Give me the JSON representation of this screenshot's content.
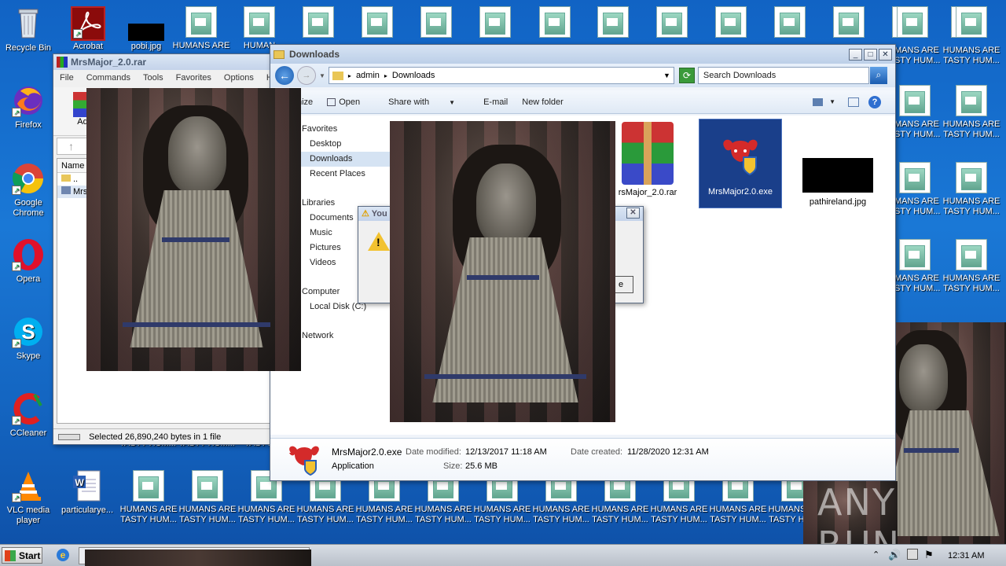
{
  "desktop": {
    "left_icons": [
      {
        "label": "Recycle Bin",
        "icon": "recycle-bin-icon"
      },
      {
        "label": "Acrobat",
        "icon": "acrobat-icon"
      },
      {
        "label": "Firefox",
        "icon": "firefox-icon"
      },
      {
        "label": "Google Chrome",
        "icon": "chrome-icon"
      },
      {
        "label": "Opera",
        "icon": "opera-icon"
      },
      {
        "label": "Skype",
        "icon": "skype-icon"
      },
      {
        "label": "CCleaner",
        "icon": "ccleaner-icon"
      },
      {
        "label": "VLC media player",
        "icon": "vlc-icon"
      },
      {
        "label": "particularye...",
        "icon": "word-doc-icon"
      },
      {
        "label": "pobi.jpg",
        "icon": "image-file-icon"
      }
    ],
    "spam_label_line1": "HUMANS ARE",
    "spam_label_line2": "TASTY HUM...",
    "spam_label_partial": "MANS ARE",
    "spam_label_partial2": "STY HUM...",
    "spam_label_cut": "TASTY HUM...",
    "spam_label_cut2": "HUMANS ARE",
    "spam_label_small": "HUMAN",
    "spam_label_tiny": "TASTY HU",
    "spam_label_edge": "TASTY HU",
    "spam_label_hum_edge": "HUMANS",
    "watermark": "ANY RUN"
  },
  "winrar": {
    "title": "MrsMajor_2.0.rar",
    "menu": [
      "File",
      "Commands",
      "Tools",
      "Favorites",
      "Options",
      "Help"
    ],
    "toolbar_add": "Ad",
    "column_name": "Name",
    "rows": [
      "..",
      "Mrs"
    ],
    "status": "Selected 26,890,240 bytes in 1 file"
  },
  "explorer": {
    "title": "Downloads",
    "breadcrumb": [
      "admin",
      "Downloads"
    ],
    "search_placeholder": "Search Downloads",
    "toolbar": [
      "nize",
      "Open",
      "Share with",
      "E-mail",
      "New folder"
    ],
    "nav": {
      "favorites": "Favorites",
      "desktop": "Desktop",
      "downloads": "Downloads",
      "recent": "Recent Places",
      "libraries": "Libraries",
      "documents": "Documents",
      "music": "Music",
      "pictures": "Pictures",
      "videos": "Videos",
      "computer": "Computer",
      "local_disk": "Local Disk (C:)",
      "network": "Network"
    },
    "files": [
      {
        "name": "rsMajor_2.0.rar"
      },
      {
        "name": "MrsMajor2.0.exe"
      },
      {
        "name": "pathireland.jpg"
      }
    ],
    "details": {
      "name": "MrsMajor2.0.exe",
      "type": "Application",
      "modified_label": "Date modified:",
      "modified": "12/13/2017 11:18 AM",
      "size_label": "Size:",
      "size": "25.6 MB",
      "created_label": "Date created:",
      "created": "11/28/2020 12:31 AM"
    }
  },
  "dialog": {
    "title": "You",
    "button_fragment": "e"
  },
  "taskbar": {
    "start": "Start",
    "time": "12:31 AM"
  },
  "colors": {
    "desktop": "#1466c2",
    "selection": "#d5e3f3",
    "exe_bg": "#1a3f8a"
  }
}
